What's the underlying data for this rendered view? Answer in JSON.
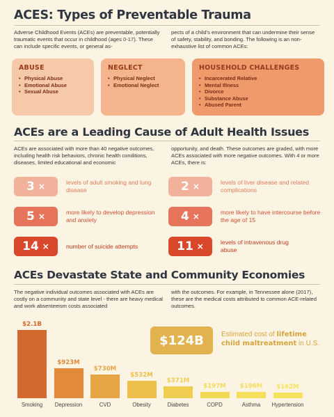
{
  "section1": {
    "title": "ACES: Types of Preventable Trauma",
    "intro_left": "Adverse Childhood Events (ACEs) are preventable, potentially traumatic events that occur in childhood (ages 0-17). These can include specific events, or general as-",
    "intro_right": "pects of a child's environment that can undermine their sense of safety, stability, and bonding. The following is an non-exhaustive list of common ACEs:",
    "cards": [
      {
        "title": "ABUSE",
        "items": [
          "Physical Abuse",
          "Emotional Abuse",
          "Sexual Abuse"
        ],
        "color": "#f6c9a8"
      },
      {
        "title": "NEGLECT",
        "items": [
          "Physical Neglect",
          "Emotional Neglect"
        ],
        "color": "#f4b48d"
      },
      {
        "title": "HOUSEHOLD CHALLENGES",
        "items": [
          "Incarcerated Relative",
          "Mental Illness",
          "Divorce",
          "Substance Abuse",
          "Abused Parent"
        ],
        "color": "#ef9a6b"
      }
    ]
  },
  "section2": {
    "title": "ACEs are a Leading Cause of Adult Health Issues",
    "intro_left": "ACEs are associated with more than 40 negative outcomes, including health risk behaviors, chronic health conditions, diseases, limited educational and economic",
    "intro_right": "opportunity, and death. These outcomes are graded, with more ACEs associated with more negative outcomes. With 4 or more ACEs, there is:",
    "stats": [
      {
        "num": "3",
        "x": "×",
        "text": "levels of adult smoking and lung disease",
        "bg": "#f2b19a",
        "fg": "#e07a5a"
      },
      {
        "num": "2",
        "x": "×",
        "text": "levels of liver disease and related complications",
        "bg": "#f2b19a",
        "fg": "#e07a5a"
      },
      {
        "num": "5",
        "x": "×",
        "text": "more likely to develop depression and anxiety",
        "bg": "#e6745a",
        "fg": "#cf4f35"
      },
      {
        "num": "4",
        "x": "×",
        "text": "more likely to have intercourse before the age of 15",
        "bg": "#e6745a",
        "fg": "#cf4f35"
      },
      {
        "num": "14",
        "x": "×",
        "text": "number of suicide attempts",
        "bg": "#d9482a",
        "fg": "#c0391d"
      },
      {
        "num": "11",
        "x": "×",
        "text": "levels of intravenous drug abuse",
        "bg": "#d9482a",
        "fg": "#c0391d"
      }
    ]
  },
  "section3": {
    "title": "ACEs Devastate State and Community Economies",
    "intro_left": "The negative individual outcomes associated with ACEs are costly on a community and state level - there are heavy medical and work absenteeism costs associated",
    "intro_right": "with the outcomes. For example, in Tennessee alone (2017), these are the medical costs attributed to common ACE-related outcomes.",
    "total": "$124B",
    "total_caption_a": "Estimated cost of ",
    "total_caption_b": "lifetime child maltreatment",
    "total_caption_c": " in U.S."
  },
  "chart_data": {
    "type": "bar",
    "categories": [
      "Smoking",
      "Depression",
      "CVD",
      "Obesity",
      "Diabetes",
      "COPD",
      "Asthma",
      "Hypertension"
    ],
    "labels": [
      "$2.1B",
      "$923M",
      "$730M",
      "$532M",
      "$371M",
      "$197M",
      "$196M",
      "$162M"
    ],
    "values": [
      2100,
      923,
      730,
      532,
      371,
      197,
      196,
      162
    ],
    "colors": [
      "#d2692f",
      "#e08a3a",
      "#e6a544",
      "#ecbe4a",
      "#efcd4e",
      "#f3da55",
      "#f4de5a",
      "#f5e35e"
    ]
  }
}
